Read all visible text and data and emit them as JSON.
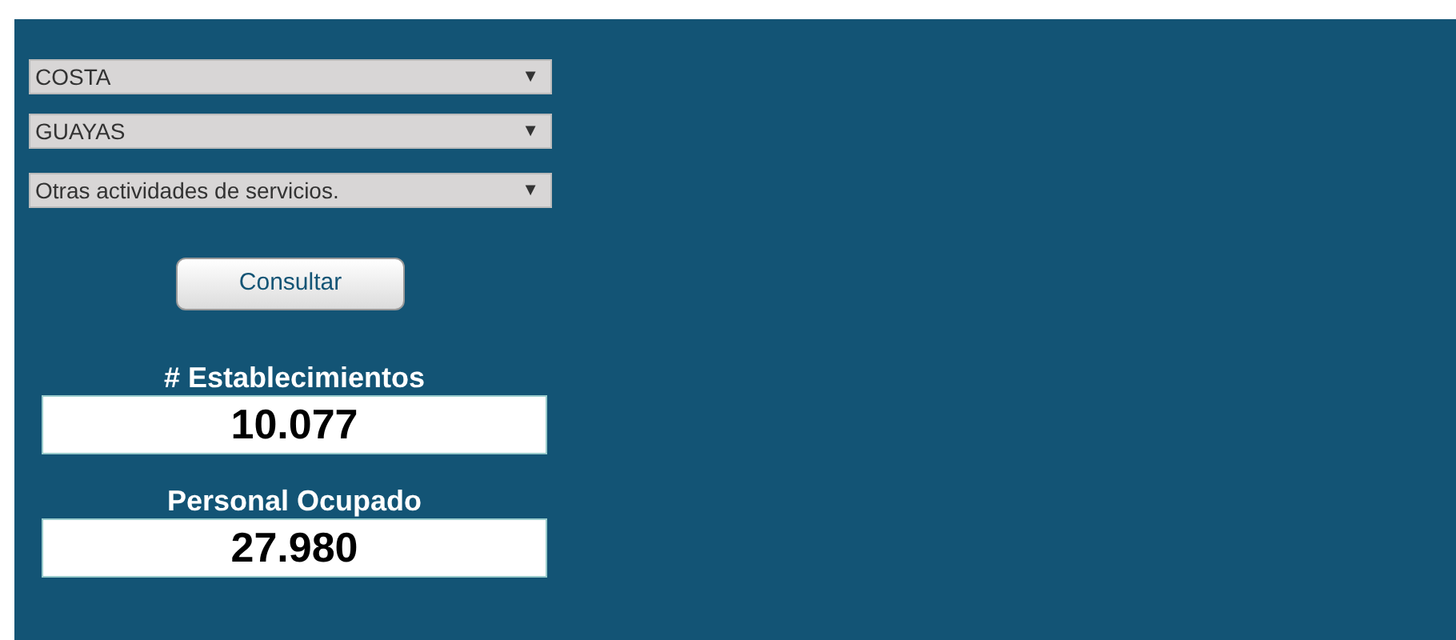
{
  "filters": [
    {
      "value": "COSTA",
      "arrow": "▼"
    },
    {
      "value": "GUAYAS",
      "arrow": "▼"
    },
    {
      "value": "Otras actividades de servicios.",
      "arrow": "▼"
    }
  ],
  "button": "Consultar",
  "results": [
    {
      "label": "# Establecimientos",
      "value": "10.077"
    },
    {
      "label": "Personal Ocupado",
      "value": "27.980"
    }
  ]
}
